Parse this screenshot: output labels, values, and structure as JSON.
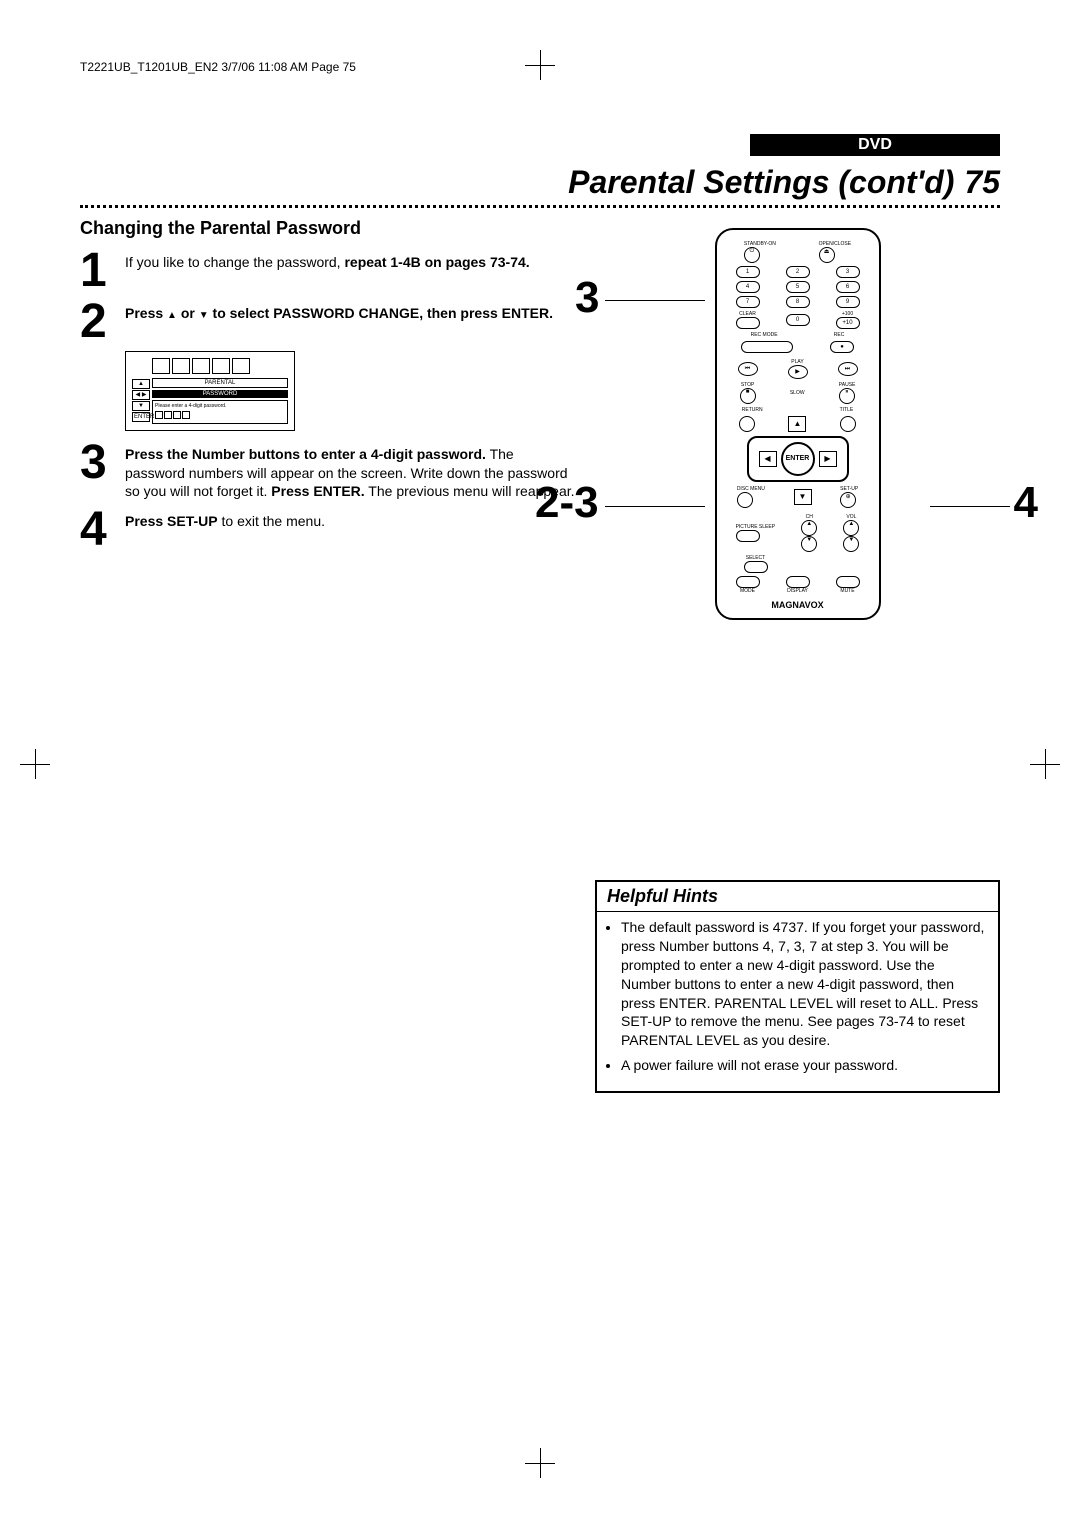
{
  "header_line": "T2221UB_T1201UB_EN2  3/7/06  11:08 AM  Page 75",
  "section": "DVD",
  "title": "Parental Settings (cont'd)",
  "page_number": "75",
  "subheading": "Changing the Parental Password",
  "steps": {
    "s1": {
      "num": "1",
      "text_a": "If you like to change the password, ",
      "text_b": "repeat 1-4B on pages 73-74."
    },
    "s2": {
      "num": "2",
      "text_a": "Press ",
      "text_b": " or ",
      "text_c": " to select PASSWORD CHANGE, then press ENTER."
    },
    "s3": {
      "num": "3",
      "text_a": "Press the Number buttons to enter a 4-digit password.",
      "text_b": "  The password numbers will appear on the screen.  Write down the password so you will not forget it.  ",
      "text_c": "Press ENTER.",
      "text_d": "  The previous menu will reappear."
    },
    "s4": {
      "num": "4",
      "text_a": "Press SET-UP",
      "text_b": " to exit the menu."
    }
  },
  "menu": {
    "parental": "PARENTAL",
    "password": "PASSWORD",
    "prompt": "Please enter a 4-digit password.",
    "nav_enter": "ENTER"
  },
  "remote": {
    "standby": "STANDBY-ON",
    "openclose": "OPEN/CLOSE",
    "n1": "1",
    "n2": "2",
    "n3": "3",
    "n4": "4",
    "n5": "5",
    "n6": "6",
    "n7": "7",
    "n8": "8",
    "n9": "9",
    "n0": "0",
    "clear": "CLEAR",
    "plus100": "+100",
    "plus10": "+10",
    "recmode": "REC MODE",
    "rec": "REC",
    "play": "PLAY",
    "stop": "STOP",
    "slow": "SLOW",
    "pause": "PAUSE",
    "return": "RETURN",
    "title": "TITLE",
    "enter": "ENTER",
    "disc": "DISC MENU",
    "setup": "SET-UP",
    "picture": "PICTURE SLEEP",
    "ch": "CH",
    "vol": "VOL",
    "select": "SELECT",
    "mode": "MODE",
    "display": "DISPLAY",
    "mute": "MUTE",
    "brand": "MAGNAVOX"
  },
  "callouts": {
    "c3": "3",
    "c23": "2-3",
    "c4": "4"
  },
  "hints": {
    "title": "Helpful Hints",
    "item1": "The default password is 4737. If you forget your password, press Number buttons 4, 7, 3, 7 at step 3.  You will be prompted to enter a new 4-digit password.  Use the Number buttons to enter a new 4-digit password, then press ENTER. PARENTAL LEVEL will reset to ALL. Press SET-UP to remove the menu. See pages 73-74 to reset PARENTAL LEVEL as you desire.",
    "item2": "A power failure will not erase your password."
  }
}
